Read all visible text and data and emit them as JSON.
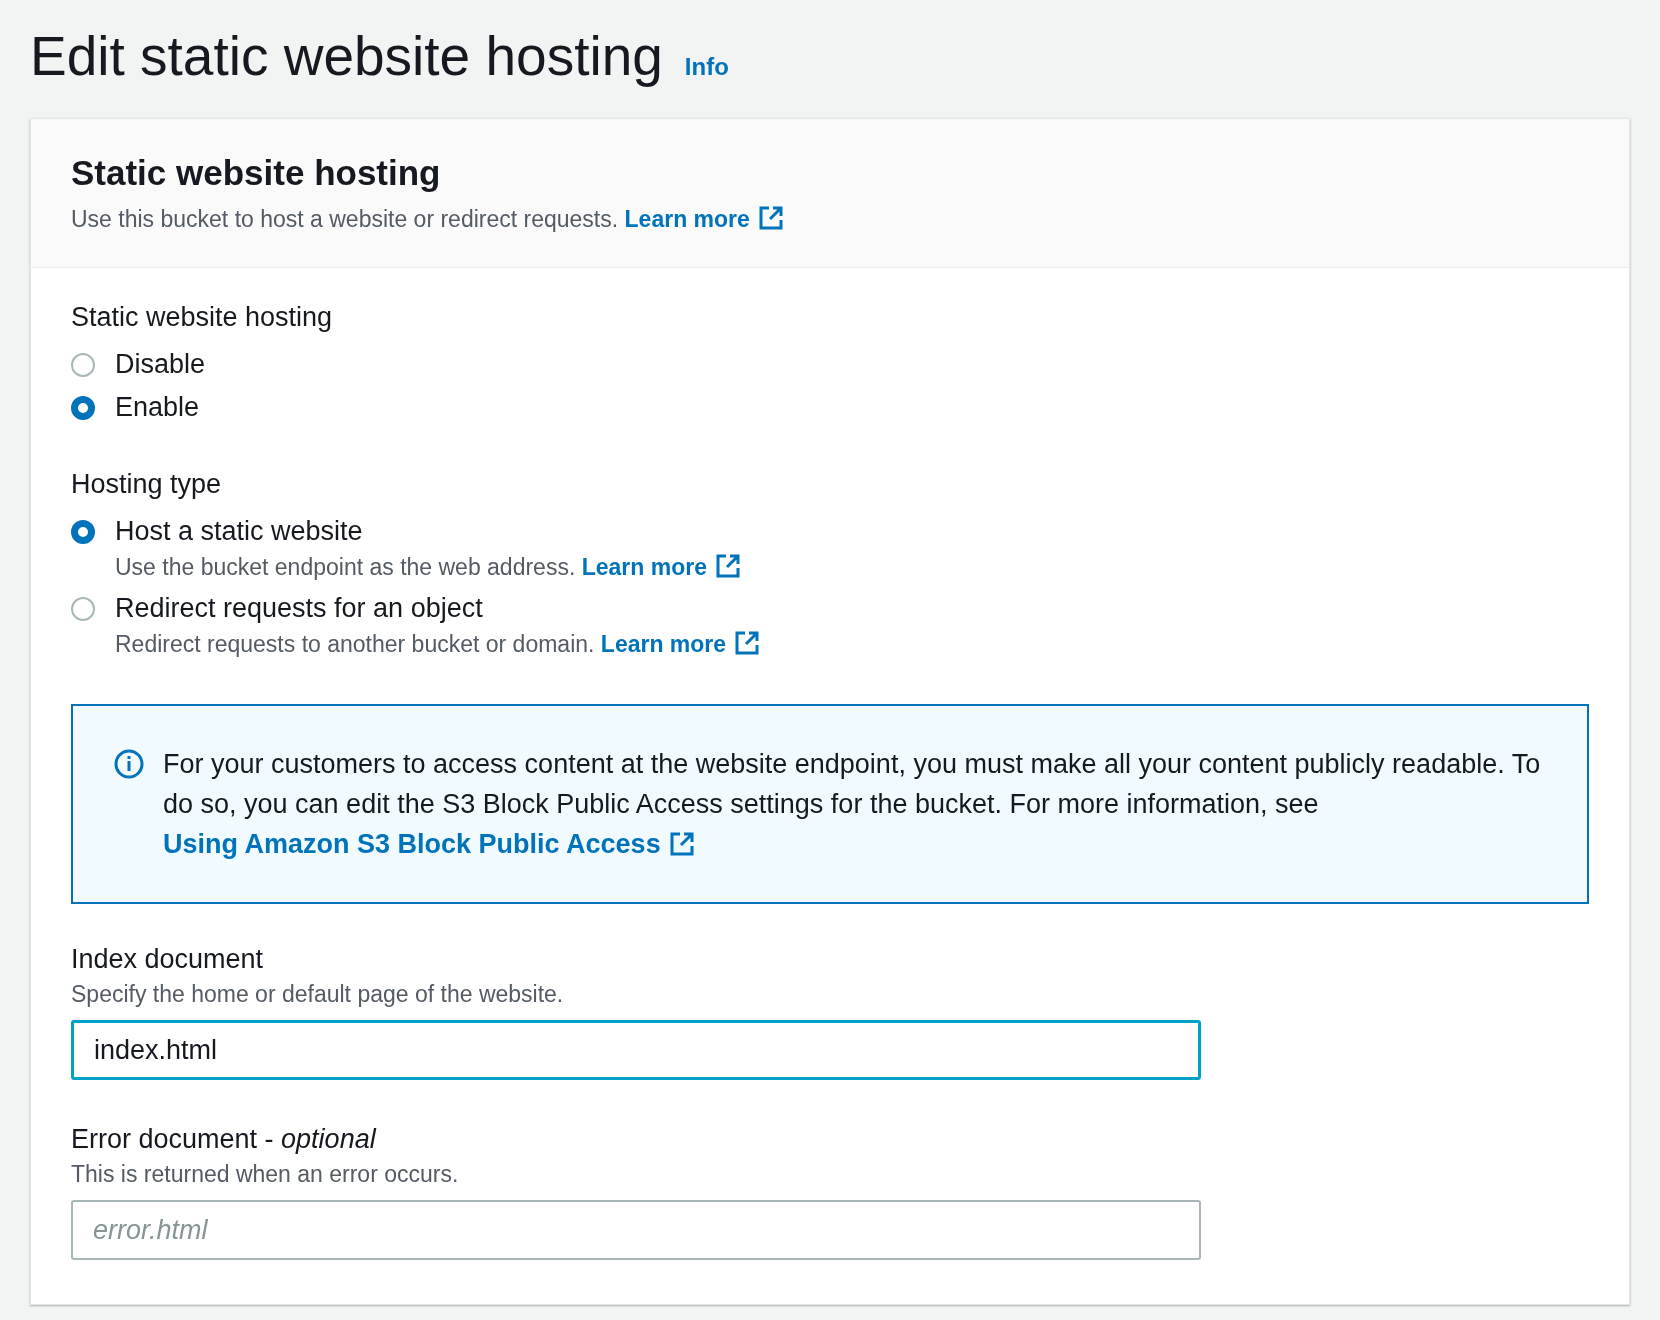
{
  "page": {
    "title": "Edit static website hosting",
    "info_link": "Info"
  },
  "panel": {
    "title": "Static website hosting",
    "description": "Use this bucket to host a website or redirect requests.",
    "link": "Learn more"
  },
  "hosting": {
    "label": "Static website hosting",
    "options": [
      {
        "label": "Disable",
        "selected": false
      },
      {
        "label": "Enable",
        "selected": true
      }
    ]
  },
  "hosting_type": {
    "label": "Hosting type",
    "options": [
      {
        "label": "Host a static website",
        "description": "Use the bucket endpoint as the web address.",
        "link": "Learn more",
        "selected": true
      },
      {
        "label": "Redirect requests for an object",
        "description": "Redirect requests to another bucket or domain.",
        "link": "Learn more",
        "selected": false
      }
    ]
  },
  "info_alert": {
    "text": "For your customers to access content at the website endpoint, you must make all your content publicly readable. To do so, you can edit the S3 Block Public Access settings for the bucket. For more information, see",
    "link": "Using Amazon S3 Block Public Access"
  },
  "fields": [
    {
      "label": "Index document",
      "description": "Specify the home or default page of the website.",
      "value": "index.html",
      "focused": true
    },
    {
      "label": "Error document - *optional*",
      "description": "This is returned when an error occurs.",
      "placeholder": "error.html",
      "focused": false
    }
  ]
}
